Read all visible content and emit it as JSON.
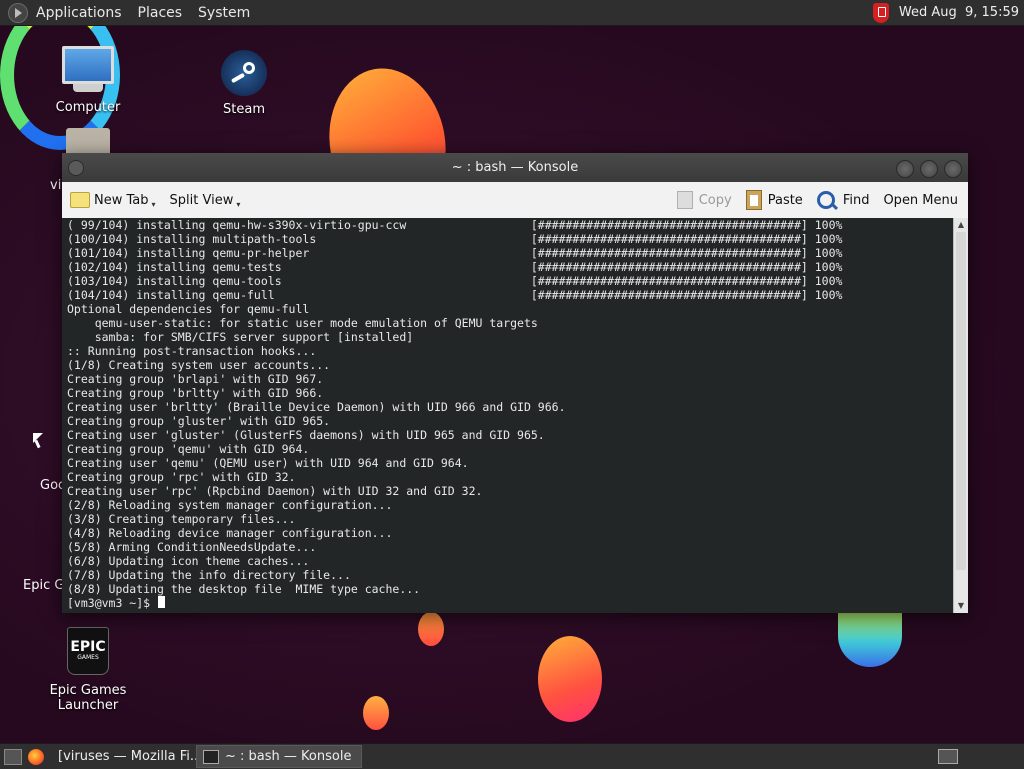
{
  "top_panel": {
    "menus": [
      "Applications",
      "Places",
      "System"
    ],
    "clock": "Wed Aug  9, 15:59",
    "icons": {
      "menu": "distro-logo-icon",
      "tray": "shield-icon"
    }
  },
  "desktop": {
    "icons": {
      "computer": "Computer",
      "steam": "Steam",
      "epic": "Epic Games Launcher",
      "epic_logo_line1": "EPIC",
      "epic_logo_line2": "GAMES"
    },
    "partial_labels": {
      "vi": "vi",
      "goo": "Goo",
      "epic_g": "Epic G"
    }
  },
  "konsole": {
    "title": "~ : bash — Konsole",
    "toolbar": {
      "new_tab": "New Tab",
      "split_view": "Split View",
      "copy": "Copy",
      "paste": "Paste",
      "find": "Find",
      "open_menu": "Open Menu"
    },
    "lines": [
      "( 99/104) installing qemu-hw-s390x-virtio-gpu-ccw                  [######################################] 100%",
      "(100/104) installing multipath-tools                               [######################################] 100%",
      "(101/104) installing qemu-pr-helper                                [######################################] 100%",
      "(102/104) installing qemu-tests                                    [######################################] 100%",
      "(103/104) installing qemu-tools                                    [######################################] 100%",
      "(104/104) installing qemu-full                                     [######################################] 100%",
      "Optional dependencies for qemu-full",
      "    qemu-user-static: for static user mode emulation of QEMU targets",
      "    samba: for SMB/CIFS server support [installed]",
      ":: Running post-transaction hooks...",
      "(1/8) Creating system user accounts...",
      "Creating group 'brlapi' with GID 967.",
      "Creating group 'brltty' with GID 966.",
      "Creating user 'brltty' (Braille Device Daemon) with UID 966 and GID 966.",
      "Creating group 'gluster' with GID 965.",
      "Creating user 'gluster' (GlusterFS daemons) with UID 965 and GID 965.",
      "Creating group 'qemu' with GID 964.",
      "Creating user 'qemu' (QEMU user) with UID 964 and GID 964.",
      "Creating group 'rpc' with GID 32.",
      "Creating user 'rpc' (Rpcbind Daemon) with UID 32 and GID 32.",
      "(2/8) Reloading system manager configuration...",
      "(3/8) Creating temporary files...",
      "(4/8) Reloading device manager configuration...",
      "(5/8) Arming ConditionNeedsUpdate...",
      "(6/8) Updating icon theme caches...",
      "(7/8) Updating the info directory file...",
      "(8/8) Updating the desktop file  MIME type cache..."
    ],
    "prompt": "[vm3@vm3 ~]$ "
  },
  "taskbar": {
    "tasks": [
      {
        "label": "[viruses — Mozilla Fi...",
        "icon": "firefox-icon"
      },
      {
        "label": "~ : bash — Konsole",
        "icon": "terminal-icon"
      }
    ]
  }
}
